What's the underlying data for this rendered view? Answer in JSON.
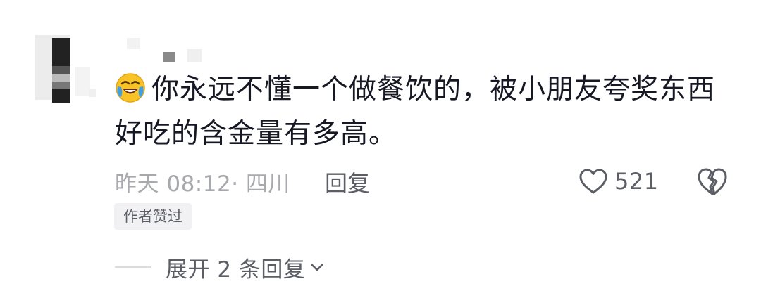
{
  "comment": {
    "emoji": "face-with-tears-of-joy-emoji",
    "text": "你永远不懂一个做餐饮的，被小朋友夸奖东西好吃的含金量有多高。"
  },
  "meta": {
    "time_location": "昨天 08:12· 四川",
    "reply_label": "回复"
  },
  "likes": {
    "count": "521",
    "icon": "heart-outline-icon",
    "dislike_icon": "broken-heart-icon"
  },
  "badge": {
    "label": "作者赞过"
  },
  "expand": {
    "label": "展开 2 条回复",
    "icon": "chevron-down-icon"
  },
  "colors": {
    "text_primary": "#161823",
    "text_secondary": "#a8a9ae",
    "text_action": "#5c5e66",
    "badge_bg": "#f1f1f3"
  }
}
